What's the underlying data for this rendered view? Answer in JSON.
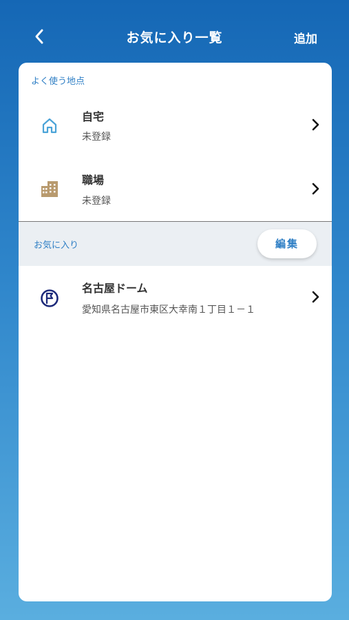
{
  "header": {
    "title": "お気に入り一覧",
    "add_label": "追加"
  },
  "frequent": {
    "label": "よく使う地点",
    "items": [
      {
        "title": "自宅",
        "subtitle": "未登録",
        "icon": "home-icon"
      },
      {
        "title": "職場",
        "subtitle": "未登録",
        "icon": "building-icon"
      }
    ]
  },
  "favorites": {
    "label": "お気に入り",
    "edit_label": "編集",
    "items": [
      {
        "title": "名古屋ドーム",
        "subtitle": "愛知県名古屋市東区大幸南１丁目１－１",
        "icon": "flag-circle-icon"
      }
    ]
  },
  "colors": {
    "accent": "#2f7fc5",
    "header_top": "#1567b5",
    "header_bottom": "#5aaedf",
    "home_icon": "#4aa3d8",
    "building_icon": "#b89a6e",
    "flag_icon": "#1d2a7a"
  }
}
